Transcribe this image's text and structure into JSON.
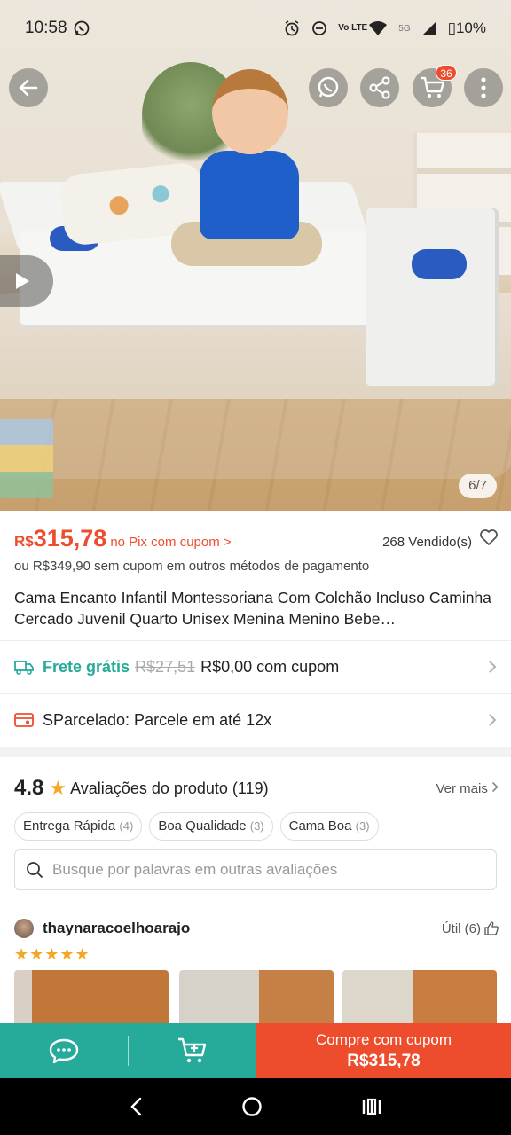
{
  "status_bar": {
    "time": "10:58",
    "network": "5G",
    "volte": "Vo LTE",
    "battery": "10%"
  },
  "image": {
    "counter": "6/7",
    "cart_badge": "36"
  },
  "price": {
    "currency": "R$",
    "value": "315,78",
    "note": "no Pix com cupom >",
    "sold": "268 Vendido(s)",
    "alt": "ou R$349,90 sem cupom em outros métodos de pagamento"
  },
  "product": {
    "title": "Cama Encanto Infantil Montessoriana Com Colchão Incluso Caminha Cercado Juvenil Quarto Unisex Menina Menino Bebe…"
  },
  "shipping": {
    "label": "Frete grátis",
    "old_price": "R$27,51",
    "new_price": "R$0,00 com cupom"
  },
  "installments": {
    "text": "SParcelado: Parcele em até 12x"
  },
  "reviews": {
    "rating": "4.8",
    "title": "Avaliações do produto (119)",
    "see_more": "Ver mais",
    "tags": [
      {
        "label": "Entrega Rápida",
        "count": "(4)"
      },
      {
        "label": "Boa Qualidade",
        "count": "(3)"
      },
      {
        "label": "Cama Boa",
        "count": "(3)"
      }
    ],
    "search_placeholder": "Busque por palavras em outras avaliações",
    "first": {
      "user": "thaynaracoelhoarajo",
      "useful": "Útil (6)",
      "stars": 5
    }
  },
  "bottom_bar": {
    "buy_line1": "Compre com cupom",
    "buy_line2": "R$315,78"
  },
  "colors": {
    "brand": "#ee4d2d",
    "teal": "#26aa99",
    "star": "#f5a623"
  }
}
